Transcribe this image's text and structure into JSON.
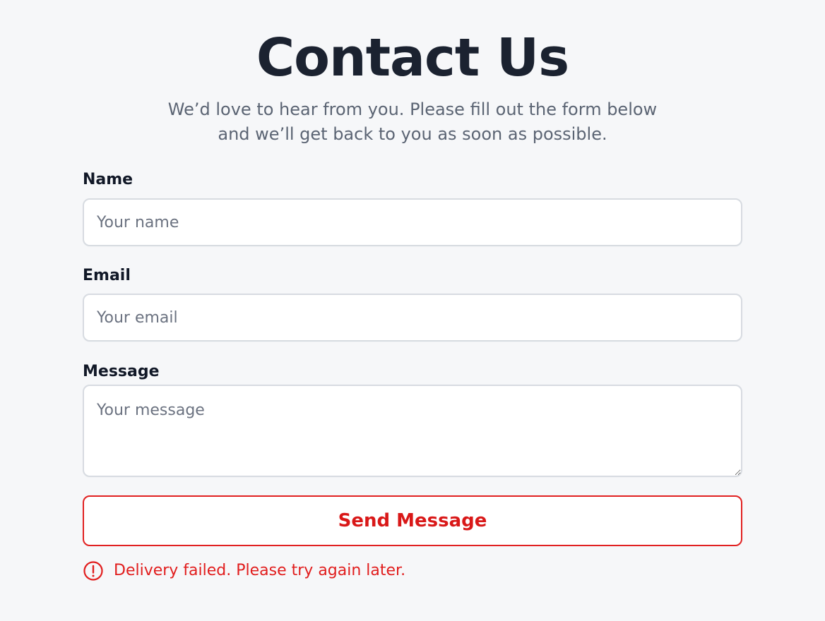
{
  "header": {
    "title": "Contact Us",
    "subtitle": "We’d love to hear from you. Please fill out the form below and we’ll get back to you as soon as possible."
  },
  "form": {
    "name_label": "Name",
    "name_placeholder": "Your name",
    "email_label": "Email",
    "email_placeholder": "Your email",
    "message_label": "Message",
    "message_placeholder": "Your message",
    "submit_label": "Send Message",
    "error_message": "Delivery failed. Please try again later."
  },
  "icons": {
    "error": "alert-circle-icon"
  },
  "colors": {
    "background": "#f6f7f9",
    "heading": "#1b2230",
    "muted_text": "#5b6473",
    "input_border": "#d7dbe1",
    "error": "#e11d1d"
  }
}
